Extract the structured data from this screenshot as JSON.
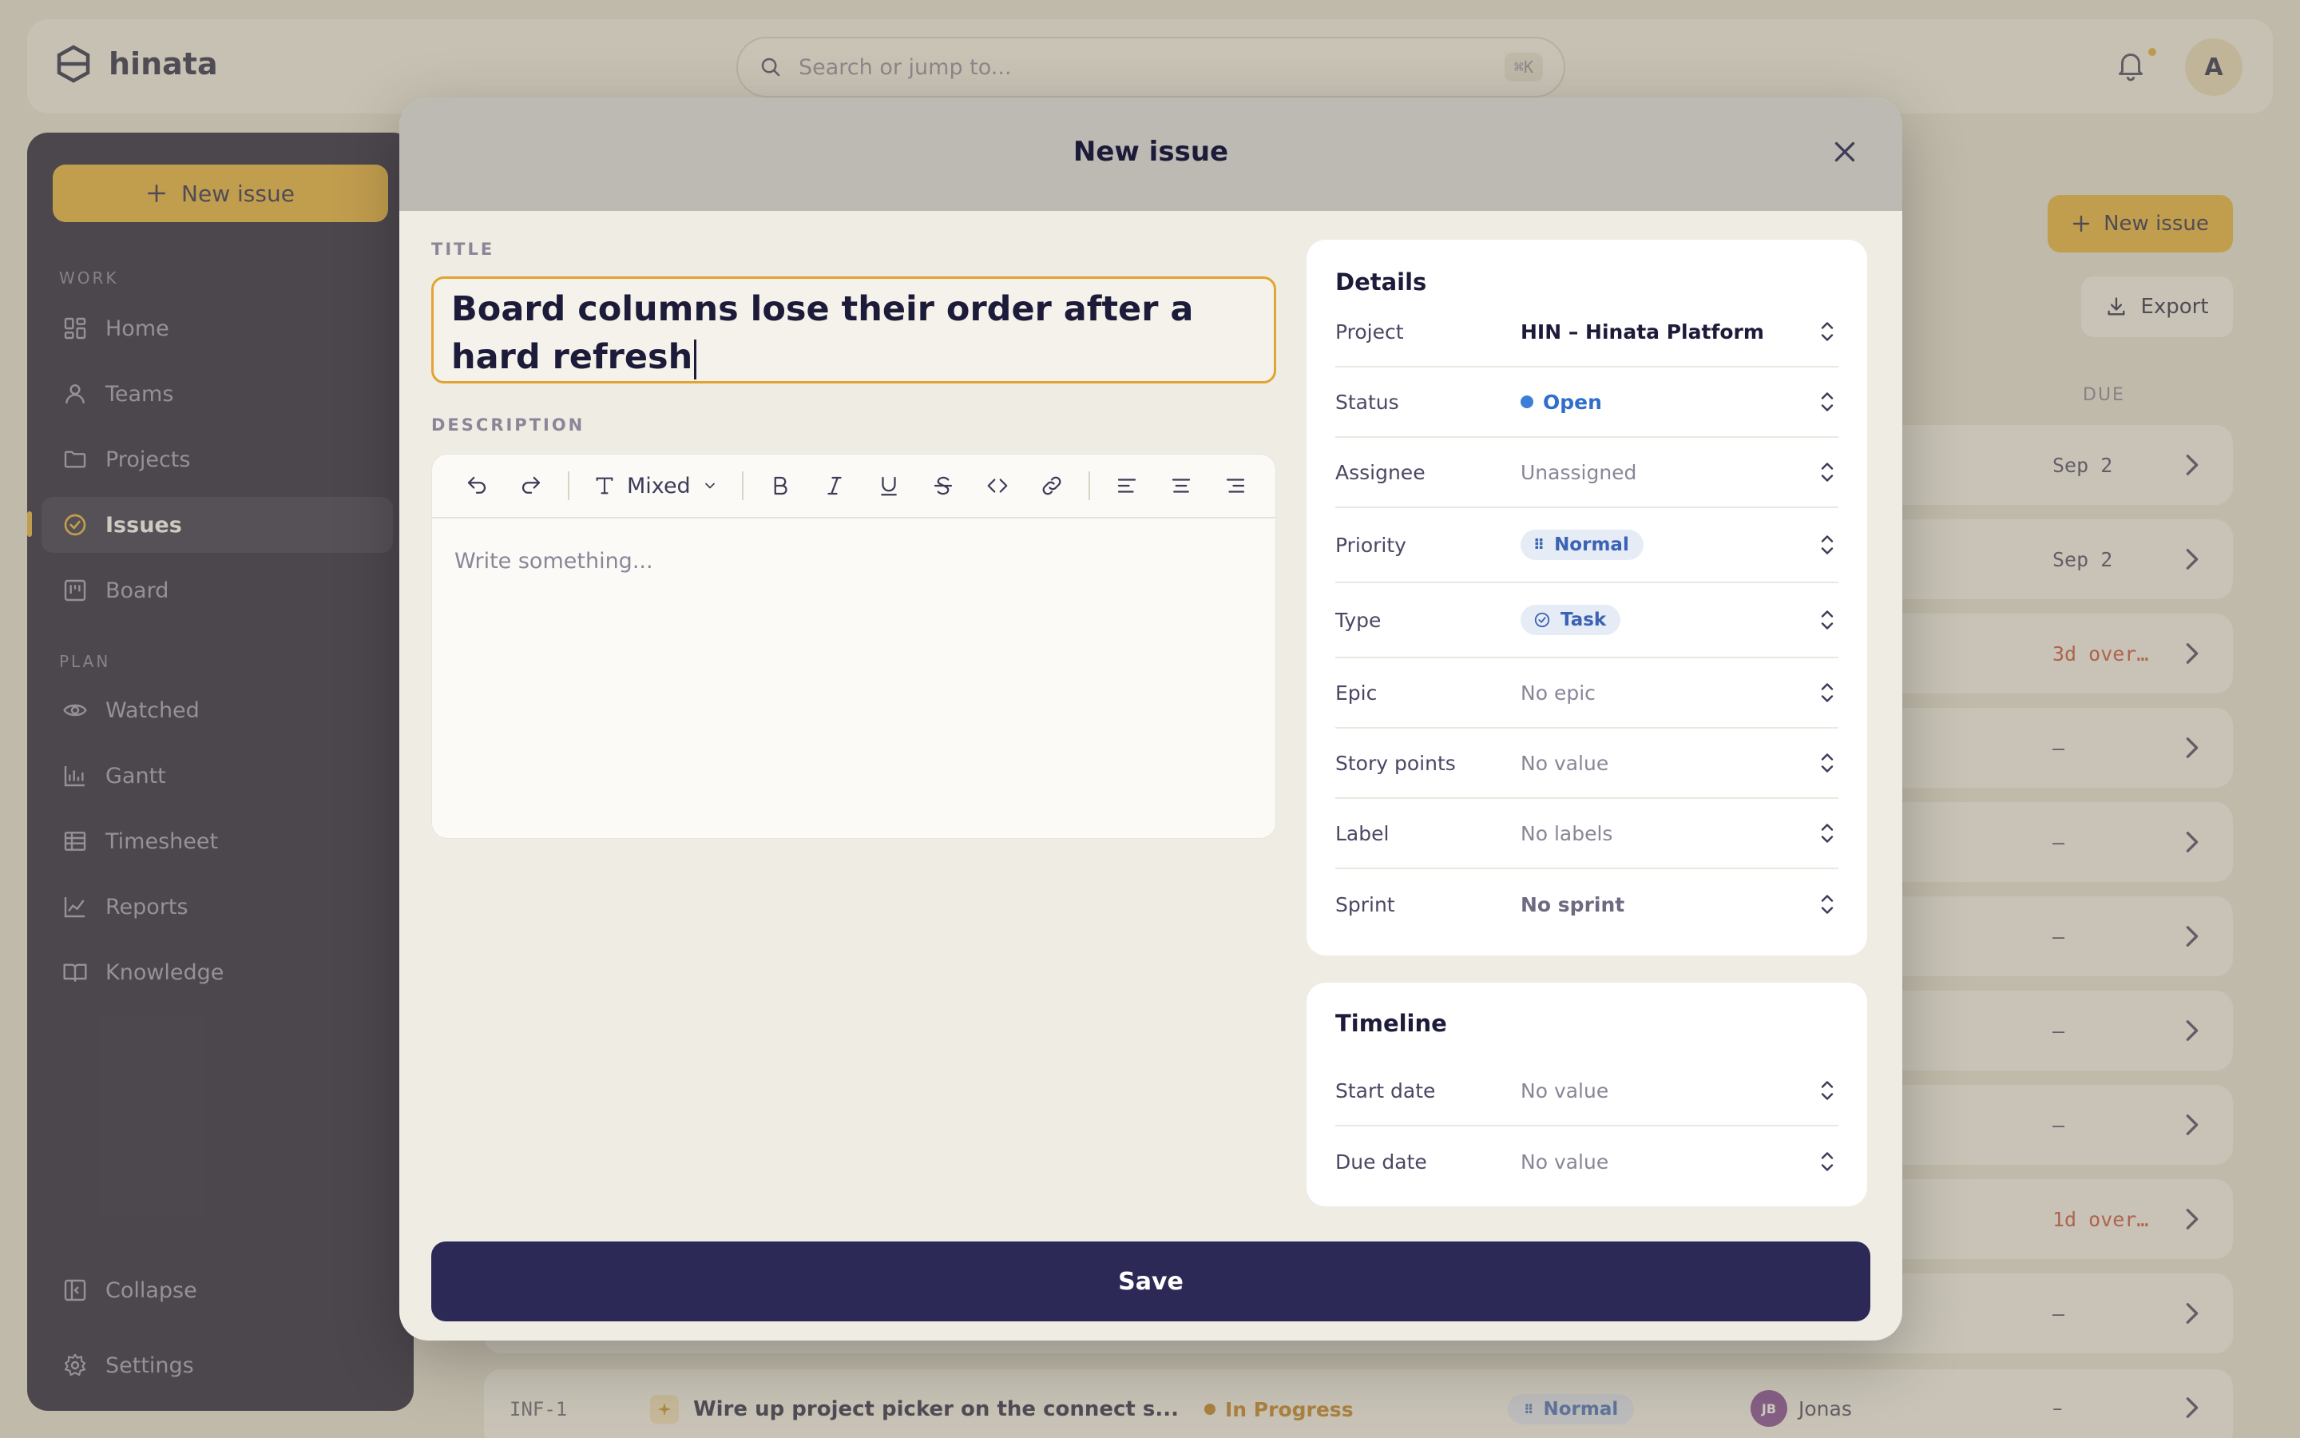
{
  "app": {
    "brand": "hinata",
    "search_placeholder": "Search or jump to...",
    "search_shortcut": "⌘K",
    "avatar_initial": "A"
  },
  "sidebar": {
    "new_issue": "New issue",
    "section_work": "WORK",
    "section_plan": "PLAN",
    "work_items": [
      {
        "label": "Home",
        "icon": "dashboard-icon"
      },
      {
        "label": "Teams",
        "icon": "user-icon"
      },
      {
        "label": "Projects",
        "icon": "folder-icon"
      },
      {
        "label": "Issues",
        "icon": "check-circle-icon",
        "active": true
      },
      {
        "label": "Board",
        "icon": "kanban-icon"
      }
    ],
    "plan_items": [
      {
        "label": "Watched",
        "icon": "eye-icon"
      },
      {
        "label": "Gantt",
        "icon": "gantt-icon"
      },
      {
        "label": "Timesheet",
        "icon": "table-icon"
      },
      {
        "label": "Reports",
        "icon": "line-chart-icon"
      },
      {
        "label": "Knowledge",
        "icon": "book-icon"
      }
    ],
    "collapse": "Collapse",
    "settings": "Settings"
  },
  "main": {
    "new_issue": "New issue",
    "export": "Export",
    "due_header": "DUE",
    "rows_due": [
      "Sep 2",
      "Sep 2",
      "3d over…",
      "–",
      "–",
      "–",
      "–",
      "–",
      "1d over…",
      "–"
    ],
    "bottom_row": {
      "id": "INF-1",
      "title": "Wire up project picker on the connect s...",
      "status": "In Progress",
      "priority": "Normal",
      "assignee_initials": "JB",
      "assignee": "Jonas",
      "due": "–"
    }
  },
  "modal": {
    "title": "New issue",
    "title_label": "TITLE",
    "title_value": "Board columns lose their order after a hard refresh",
    "description_label": "DESCRIPTION",
    "text_style": "Mixed",
    "description_placeholder": "Write something...",
    "details_title": "Details",
    "details": {
      "project": {
        "label": "Project",
        "value": "HIN – Hinata Platform"
      },
      "status": {
        "label": "Status",
        "value": "Open"
      },
      "assignee": {
        "label": "Assignee",
        "value": "Unassigned"
      },
      "priority": {
        "label": "Priority",
        "value": "Normal"
      },
      "type": {
        "label": "Type",
        "value": "Task"
      },
      "epic": {
        "label": "Epic",
        "value": "No epic"
      },
      "story_points": {
        "label": "Story points",
        "value": "No value"
      },
      "label": {
        "label": "Label",
        "value": "No labels"
      },
      "sprint": {
        "label": "Sprint",
        "value": "No sprint"
      }
    },
    "timeline_title": "Timeline",
    "timeline": {
      "start": {
        "label": "Start date",
        "value": "No value"
      },
      "due": {
        "label": "Due date",
        "value": "No value"
      }
    },
    "save": "Save"
  },
  "colors": {
    "accent": "#e9ad2c",
    "primary": "#2c2957",
    "status_open": "#3b7fd9",
    "sidebar_bg": "#14122b"
  }
}
